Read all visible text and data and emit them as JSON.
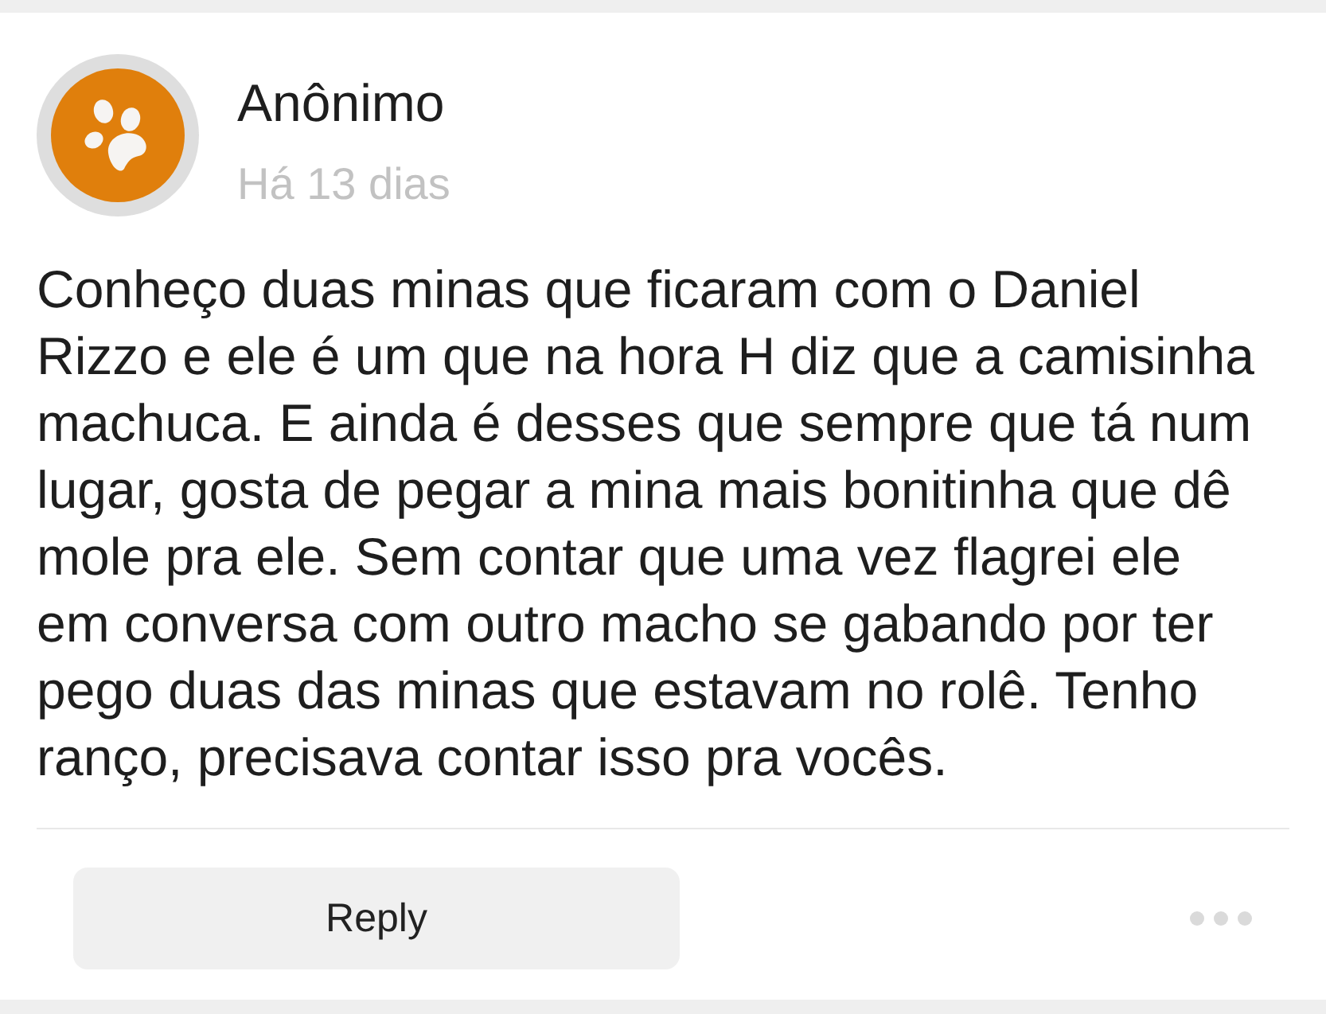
{
  "post": {
    "author": "Anônimo",
    "time": "Há 13 dias",
    "body": "Conheço duas minas que ficaram com o Daniel Rizzo e ele é um que na hora H diz que a camisinha machuca. E ainda é desses que sempre que tá num lugar, gosta de pegar a mina mais bonitinha que dê mole pra ele. Sem contar que uma vez flagrei ele em conversa com outro macho se gabando por ter pego duas das minas que estavam no rolê. Tenho ranço, precisava contar isso pra vocês."
  },
  "actions": {
    "reply_button": "Reply"
  }
}
